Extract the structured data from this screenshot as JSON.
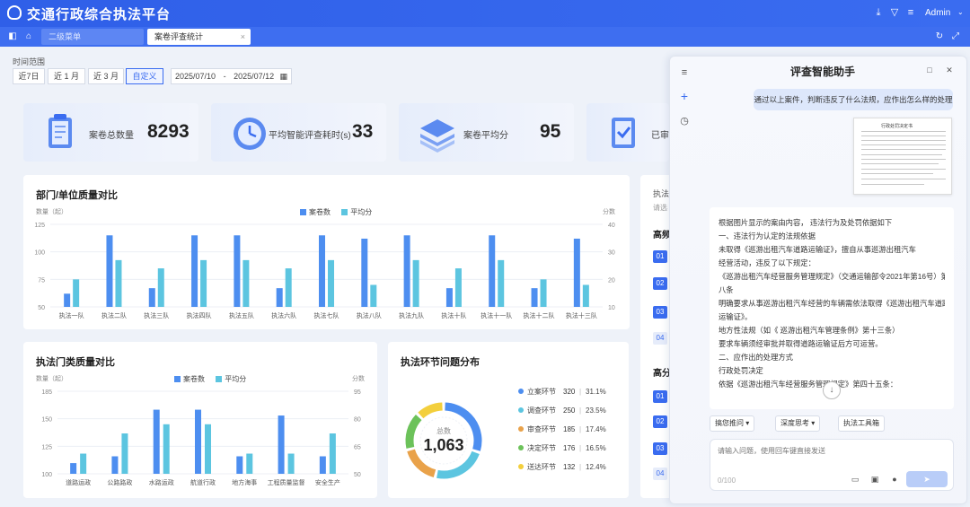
{
  "header": {
    "title": "交通行政综合执法平台",
    "user": "Admin",
    "caret": "⌄"
  },
  "tabs": [
    {
      "label": "二级菜单"
    },
    {
      "label": "案卷评查统计",
      "close": "×"
    }
  ],
  "filters": {
    "label": "时间范围",
    "buttons": [
      "近7日",
      "近 1 月",
      "近 3 月",
      "自定义"
    ],
    "start": "2025/07/10",
    "separator": "-",
    "end": "2025/07/12"
  },
  "cards": [
    {
      "label": "案卷总数量",
      "value": "8293"
    },
    {
      "label": "平均智能评查耗时(s)",
      "value": "33"
    },
    {
      "label": "案卷平均分",
      "value": "95"
    },
    {
      "label": "已审",
      "value": ""
    }
  ],
  "panels": {
    "dept": {
      "title": "部门/单位质量对比"
    },
    "category": {
      "title": "执法门类质量对比"
    },
    "stage": {
      "title": "执法环节问题分布"
    },
    "right": {
      "labels": [
        "执法",
        "请选",
        "高频",
        "高分"
      ],
      "numbers": [
        "01",
        "02",
        "03",
        "04",
        "01",
        "02",
        "03",
        "04"
      ]
    }
  },
  "chart_data": [
    {
      "type": "bar",
      "title": "部门/单位质量对比",
      "ylabel": "数量（起）",
      "y2label": "分数",
      "ylim": [
        50,
        125
      ],
      "y2lim": [
        10,
        40
      ],
      "yticks": [
        "125",
        "100",
        "75",
        "50"
      ],
      "y2ticks": [
        "40",
        "30",
        "20",
        "10"
      ],
      "categories": [
        "执法一队",
        "执法二队",
        "执法三队",
        "执法四队",
        "执法五队",
        "执法六队",
        "执法七队",
        "执法八队",
        "执法九队",
        "执法十队",
        "执法十一队",
        "执法十二队",
        "执法十三队"
      ],
      "series": [
        {
          "name": "案卷数",
          "axis": "left",
          "values": [
            62,
            115,
            67,
            115,
            115,
            67,
            115,
            112,
            115,
            67,
            115,
            67,
            112
          ]
        },
        {
          "name": "平均分",
          "axis": "right",
          "values": [
            20,
            27,
            24,
            27,
            27,
            24,
            27,
            18,
            27,
            24,
            27,
            20,
            18
          ]
        }
      ]
    },
    {
      "type": "bar",
      "title": "执法门类质量对比",
      "ylabel": "数量（起）",
      "y2label": "分数",
      "ylim": [
        100,
        185
      ],
      "y2lim": [
        50,
        95
      ],
      "yticks": [
        "185",
        "150",
        "125",
        "100"
      ],
      "y2ticks": [
        "95",
        "80",
        "65",
        "50"
      ],
      "categories": [
        "道路运政",
        "公路路政",
        "水路运政",
        "航道行政",
        "地方海事",
        "工程质量监督",
        "安全生产"
      ],
      "series": [
        {
          "name": "案卷数",
          "axis": "left",
          "values": [
            111,
            118,
            166,
            166,
            118,
            160,
            118
          ]
        },
        {
          "name": "平均分",
          "axis": "right",
          "values": [
            61,
            72,
            77,
            77,
            61,
            61,
            72
          ]
        }
      ]
    },
    {
      "type": "pie",
      "title": "执法环节问题分布",
      "total_label": "总数",
      "total": "1,063",
      "slices": [
        {
          "name": "立案环节",
          "value": 320,
          "pct": "31.1%",
          "color": "#4d8ef0"
        },
        {
          "name": "调查环节",
          "value": 250,
          "pct": "23.5%",
          "color": "#5cc5e0"
        },
        {
          "name": "审查环节",
          "value": 185,
          "pct": "17.4%",
          "color": "#e9a24a"
        },
        {
          "name": "决定环节",
          "value": 176,
          "pct": "16.5%",
          "color": "#6cc25a"
        },
        {
          "name": "送达环节",
          "value": 132,
          "pct": "12.4%",
          "color": "#f3cf3c"
        }
      ]
    }
  ],
  "assistant": {
    "title": "评查智能助手",
    "user_message": "通过以上案件，判断违反了什么法规，应作出怎么样的处理",
    "doc_title": "行政处罚决定书",
    "answer": [
      "根据图片显示的案由内容，          违法行为及处罚依据如下",
      "一、违法行为认定的法规依据",
      "          未取得《巡游出租汽车道路运输证》，擅自从事巡游出租汽车",
      "经营活动，违反了以下规定：",
      "《巡游出租汽车经营服务管理规定》（交通运输部令2021年第16号）第",
      "八条",
      "明确要求从事巡游出租汽车经营的车辆需依法取得《巡游出租汽车道路",
      "运输证》。",
      "地方性法规（如《          巡游出租汽车管理条例》第十三条）",
      "要求车辆须经审批并取得道路运输证后方可运营。",
      "二、应作出的处理方式",
      "行政处罚决定",
      "依据《巡游出租汽车经营服务管理规定》第四十五条："
    ],
    "pills": [
      "搞您推问 ▾",
      "深度思考 ▾",
      "执法工具箱"
    ],
    "input_placeholder": "请输入问题，使用回车键直接发送",
    "counter": "0/100",
    "send": "➤"
  },
  "colors": {
    "primary": "#3a6cf0",
    "bar1": "#4d8ef0",
    "bar2": "#5cc5e0"
  }
}
